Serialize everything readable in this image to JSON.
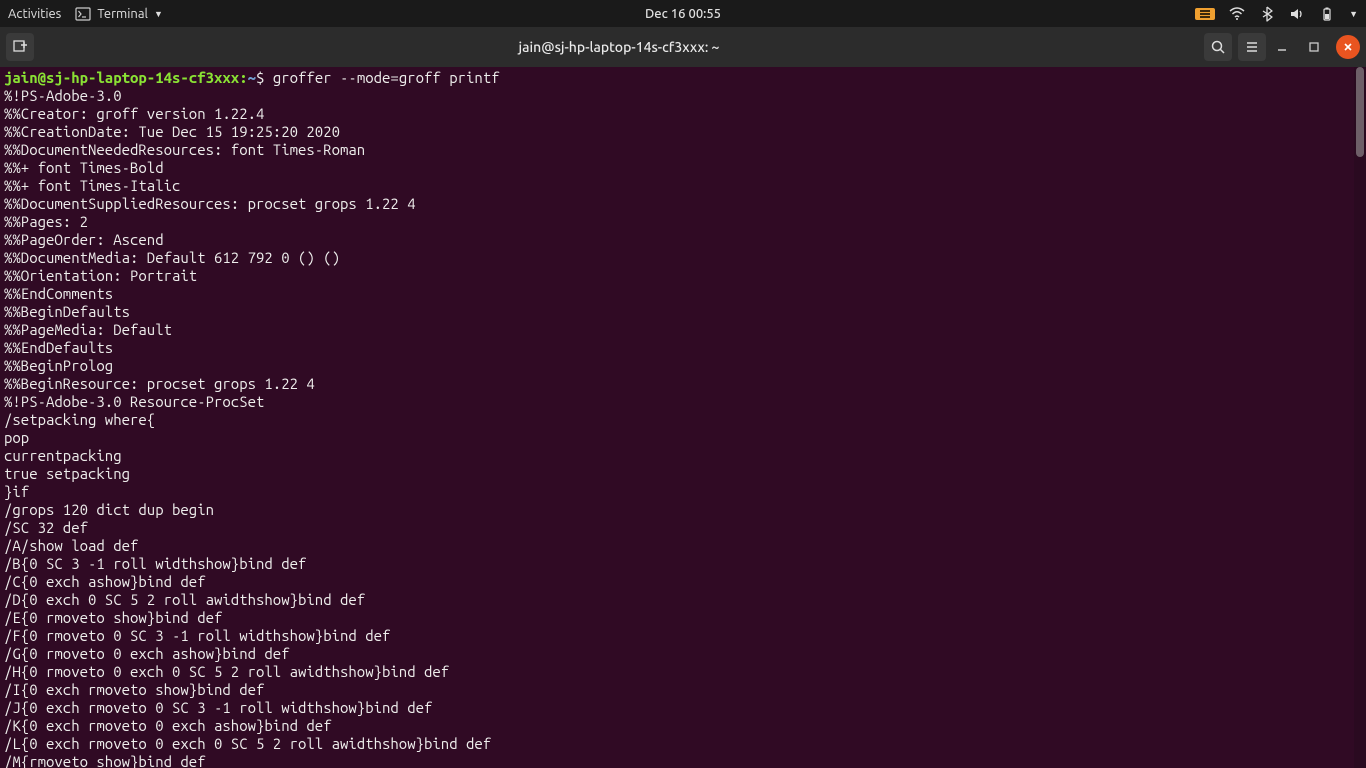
{
  "top_panel": {
    "activities": "Activities",
    "app_name": "Terminal",
    "clock": "Dec 16  00:55"
  },
  "titlebar": {
    "title": "jain@sj-hp-laptop-14s-cf3xxx: ~"
  },
  "terminal": {
    "prompt_user": "jain@sj-hp-laptop-14s-cf3xxx",
    "prompt_sep": ":",
    "prompt_path": "~",
    "prompt_symbol": "$ ",
    "command": "groffer --mode=groff printf",
    "output_lines": [
      "%!PS-Adobe-3.0",
      "%%Creator: groff version 1.22.4",
      "%%CreationDate: Tue Dec 15 19:25:20 2020",
      "%%DocumentNeededResources: font Times-Roman",
      "%%+ font Times-Bold",
      "%%+ font Times-Italic",
      "%%DocumentSuppliedResources: procset grops 1.22 4",
      "%%Pages: 2",
      "%%PageOrder: Ascend",
      "%%DocumentMedia: Default 612 792 0 () ()",
      "%%Orientation: Portrait",
      "%%EndComments",
      "%%BeginDefaults",
      "%%PageMedia: Default",
      "%%EndDefaults",
      "%%BeginProlog",
      "%%BeginResource: procset grops 1.22 4",
      "%!PS-Adobe-3.0 Resource-ProcSet",
      "/setpacking where{",
      "pop",
      "currentpacking",
      "true setpacking",
      "}if",
      "/grops 120 dict dup begin",
      "/SC 32 def",
      "/A/show load def",
      "/B{0 SC 3 -1 roll widthshow}bind def",
      "/C{0 exch ashow}bind def",
      "/D{0 exch 0 SC 5 2 roll awidthshow}bind def",
      "/E{0 rmoveto show}bind def",
      "/F{0 rmoveto 0 SC 3 -1 roll widthshow}bind def",
      "/G{0 rmoveto 0 exch ashow}bind def",
      "/H{0 rmoveto 0 exch 0 SC 5 2 roll awidthshow}bind def",
      "/I{0 exch rmoveto show}bind def",
      "/J{0 exch rmoveto 0 SC 3 -1 roll widthshow}bind def",
      "/K{0 exch rmoveto 0 exch ashow}bind def",
      "/L{0 exch rmoveto 0 exch 0 SC 5 2 roll awidthshow}bind def",
      "/M{rmoveto show}bind def"
    ]
  }
}
